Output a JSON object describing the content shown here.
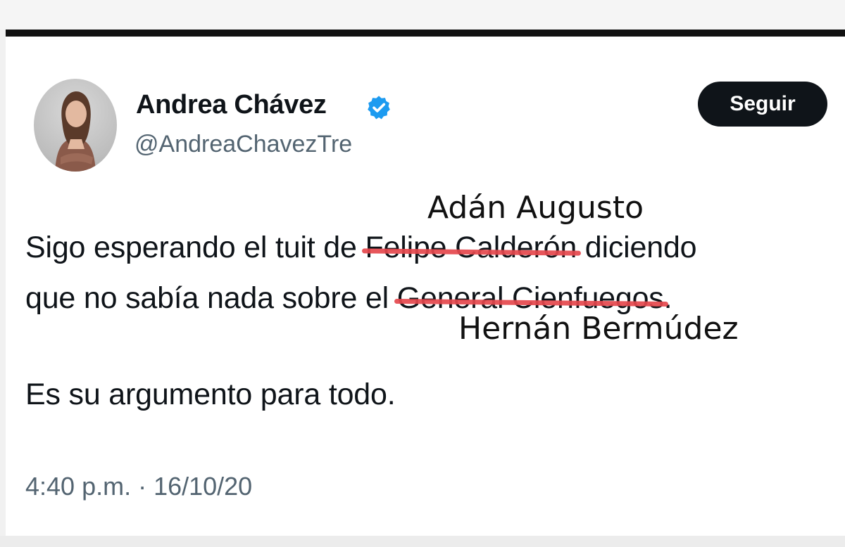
{
  "tweet": {
    "author": {
      "display_name": "Andrea Chávez",
      "handle": "@AndreaChavezTre",
      "verified_icon": "verified-badge-icon",
      "avatar_icon": "profile-photo"
    },
    "follow_button_label": "Seguir",
    "text": {
      "line1_prefix": "Sigo esperando el tuit de ",
      "line1_struck": "Felipe Calderón",
      "line1_suffix": " diciendo",
      "line2_prefix": "que no sabía nada sobre el ",
      "line2_struck": "General Cienfuegos",
      "line2_suffix": ".",
      "line3": "Es su argumento para todo."
    },
    "handwritten_edits": {
      "above": "Adán Augusto",
      "below": "Hernán Bermúdez"
    },
    "timestamp": "4:40 p.m. · 16/10/20"
  },
  "colors": {
    "follow_button_bg": "#0f1419",
    "verified_blue": "#1d9bf0",
    "strike_red": "#e5484d",
    "secondary_text": "#536471"
  }
}
